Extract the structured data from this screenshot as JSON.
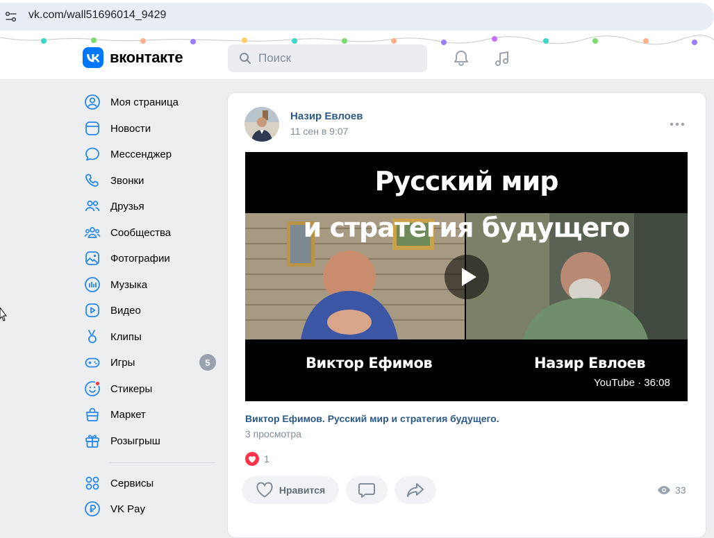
{
  "browser": {
    "url": "vk.com/wall51696014_9429"
  },
  "header": {
    "brand": "вконтакте",
    "search_placeholder": "Поиск"
  },
  "sidebar": {
    "items": [
      {
        "label": "Моя страница",
        "icon": "user-circle-icon"
      },
      {
        "label": "Новости",
        "icon": "news-icon"
      },
      {
        "label": "Мессенджер",
        "icon": "message-icon"
      },
      {
        "label": "Звонки",
        "icon": "phone-icon"
      },
      {
        "label": "Друзья",
        "icon": "friends-icon"
      },
      {
        "label": "Сообщества",
        "icon": "communities-icon"
      },
      {
        "label": "Фотографии",
        "icon": "photo-icon"
      },
      {
        "label": "Музыка",
        "icon": "music-chart-icon"
      },
      {
        "label": "Видео",
        "icon": "video-icon"
      },
      {
        "label": "Клипы",
        "icon": "clips-icon"
      },
      {
        "label": "Игры",
        "icon": "gamepad-icon",
        "badge": "5"
      },
      {
        "label": "Стикеры",
        "icon": "sticker-icon"
      },
      {
        "label": "Маркет",
        "icon": "market-bag-icon"
      },
      {
        "label": "Розыгрыш",
        "icon": "gift-icon"
      },
      {
        "label": "Сервисы",
        "icon": "services-grid-icon"
      },
      {
        "label": "VK Pay",
        "icon": "vkpay-icon"
      }
    ]
  },
  "post": {
    "author": "Назир Евлоев",
    "date": "11 сен в 9:07",
    "video": {
      "title_line1": "Русский мир",
      "title_line2": "и стратегия будущего",
      "speaker_left": "Виктор Ефимов",
      "speaker_right": "Назир Евлоев",
      "source_duration": "YouTube · 36:08"
    },
    "caption": "Виктор Ефимов. Русский мир и стратегия будущего.",
    "views_text": "3 просмотра",
    "likes_count": "1",
    "like_button_label": "Нравится",
    "eye_count": "33"
  },
  "colors": {
    "vk_blue": "#0077ff",
    "link_blue": "#2c5987",
    "icon_blue": "#2688eb",
    "like_red": "#ff3347"
  }
}
